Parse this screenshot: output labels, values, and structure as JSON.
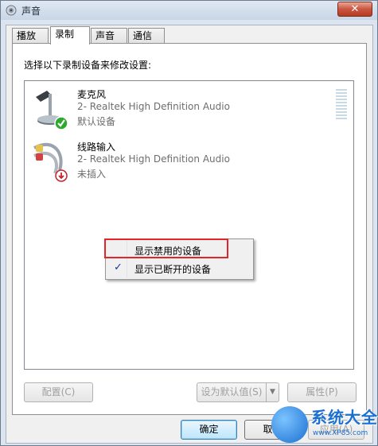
{
  "window": {
    "title": "声音",
    "close_label": "✕"
  },
  "tabs": [
    {
      "label": "播放"
    },
    {
      "label": "录制"
    },
    {
      "label": "声音"
    },
    {
      "label": "通信"
    }
  ],
  "recording": {
    "instruction": "选择以下录制设备来修改设置:",
    "devices": [
      {
        "name": "麦克风",
        "driver": "2- Realtek High Definition Audio",
        "status": "默认设备",
        "icon": "microphone-icon",
        "badge": "green-check-badge"
      },
      {
        "name": "线路输入",
        "driver": "2- Realtek High Definition Audio",
        "status": "未插入",
        "icon": "line-in-cable-icon",
        "badge": "red-down-arrow-badge"
      }
    ]
  },
  "context_menu": {
    "items": [
      {
        "label": "显示禁用的设备",
        "checked": false
      },
      {
        "label": "显示已断开的设备",
        "checked": true
      }
    ],
    "check_glyph": "✓"
  },
  "buttons": {
    "configure": "配置(C)",
    "set_default": "设为默认值(S)",
    "properties": "属性(P)",
    "ok": "确定",
    "cancel": "取消",
    "apply": "应用(A)"
  },
  "watermark": {
    "text": "系统大全",
    "url": "www.XP85.com"
  },
  "colors": {
    "accent": "#1a6fd0",
    "highlight_box": "#e0262a",
    "default_badge": "#2fa82f",
    "unplugged_badge": "#c8202a"
  }
}
